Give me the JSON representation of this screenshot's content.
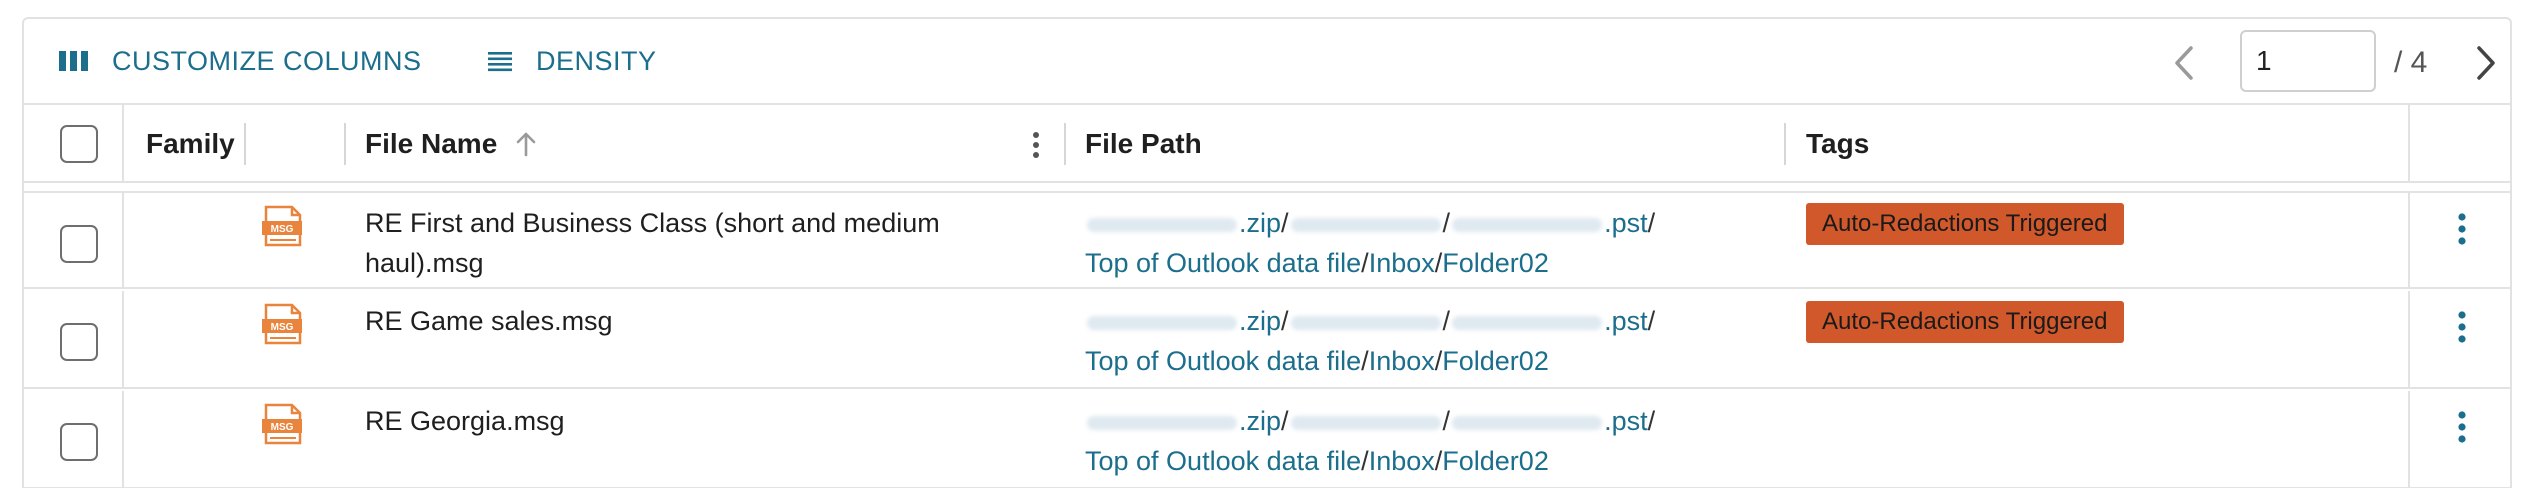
{
  "toolbar": {
    "customize_columns_label": "CUSTOMIZE COLUMNS",
    "density_label": "DENSITY",
    "icons": {
      "columns": "view-column-icon",
      "density": "density-lines-icon"
    }
  },
  "pager": {
    "page_value": "1",
    "total_label": "/ 4",
    "prev_icon": "chevron-left-icon",
    "next_icon": "chevron-right-icon"
  },
  "header": {
    "family": "Family",
    "file_name": "File Name",
    "file_path": "File Path",
    "tags": "Tags",
    "sort_icon": "arrow-up-icon",
    "menu_icon": "more-vertical-icon"
  },
  "rows": [
    {
      "file_name": "RE First and Business Class (short and medium haul).msg",
      "path_zip_ext": ".zip",
      "path_pst_ext": ".pst",
      "path_folder_a": "Top of Outlook data file",
      "path_folder_b": "Inbox",
      "path_folder_c": "Folder02",
      "sep": "/",
      "tag": "Auto-Redactions Triggered"
    },
    {
      "file_name": "RE Game sales.msg",
      "path_zip_ext": ".zip",
      "path_pst_ext": ".pst",
      "path_folder_a": "Top of Outlook data file",
      "path_folder_b": "Inbox",
      "path_folder_c": "Folder02",
      "sep": "/",
      "tag": "Auto-Redactions Triggered"
    },
    {
      "file_name": "RE Georgia.msg",
      "path_zip_ext": ".zip",
      "path_pst_ext": ".pst",
      "path_folder_a": "Top of Outlook data file",
      "path_folder_b": "Inbox",
      "path_folder_c": "Folder02",
      "sep": "/",
      "tag": ""
    }
  ],
  "colors": {
    "accent": "#1b6e8c",
    "tag_bg": "#d1582b",
    "msg_icon": "#e8843c"
  }
}
